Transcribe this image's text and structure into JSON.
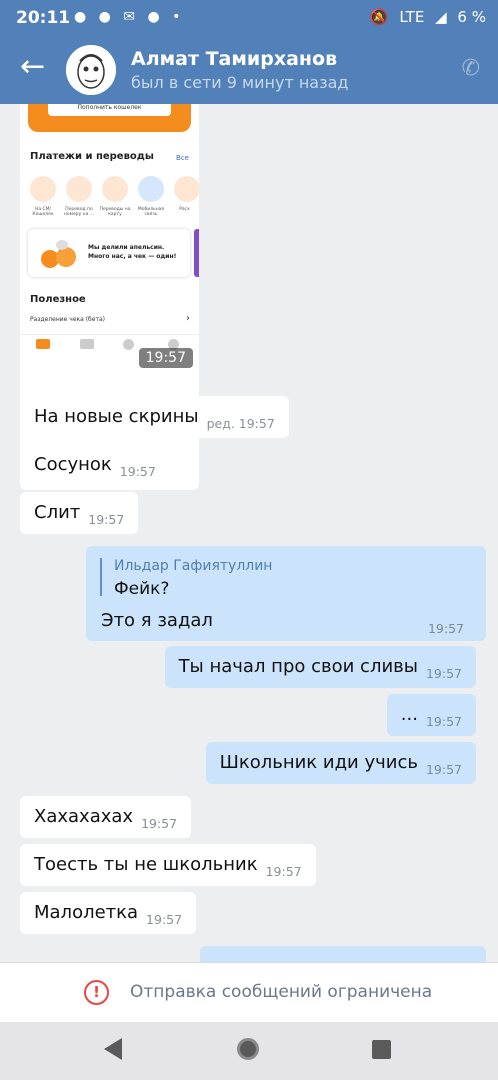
{
  "status_bar": {
    "time": "20:11",
    "network": "LTE",
    "battery": "6 %"
  },
  "header": {
    "name": "Алмат Тамирханов",
    "status": "был в сети 9 минут назад"
  },
  "screenshot_attachment": {
    "pay_button": "Пополнить кошелек",
    "section_payments": "Платежи и переводы",
    "see_all": "Все",
    "items": [
      "На СМ/ Кошелек",
      "Перевод по номеру на ...",
      "Переводы на карту",
      "Мобильная связь",
      "Расх"
    ],
    "banner_text": "Мы делили апельсин. Много нас, а чек — один!",
    "section_useful": "Полезное",
    "useful_row": "Разделение чека (бета)",
    "tabs": [
      "Главная",
      "Карты",
      "История",
      "Профиль"
    ],
    "time": "19:57"
  },
  "messages": [
    {
      "text": "На новые скрины",
      "time": "ред. 19:57"
    },
    {
      "text": "Сосунок",
      "time": "19:57"
    },
    {
      "text": "Слит",
      "time": "19:57"
    },
    {
      "quote_author": "Ильдар Гафиятуллин",
      "quote_text": "Фейк?",
      "text": "Это я задал",
      "time": "19:57"
    },
    {
      "text": "Ты начал про свои сливы",
      "time": "19:57"
    },
    {
      "text": "...",
      "time": "19:57"
    },
    {
      "text": "Школьник иди учись",
      "time": "19:57"
    },
    {
      "text": "Хахахахах",
      "time": "19:57"
    },
    {
      "text": "Тоесть ты не школьник",
      "time": "19:57"
    },
    {
      "text": "Малолетка",
      "time": "19:57"
    }
  ],
  "restriction": {
    "text": "Отправка сообщений ограничена"
  },
  "colors": {
    "header": "#5181b8",
    "incoming": "#ffffff",
    "outgoing": "#cce4fb",
    "warning": "#e64646"
  }
}
